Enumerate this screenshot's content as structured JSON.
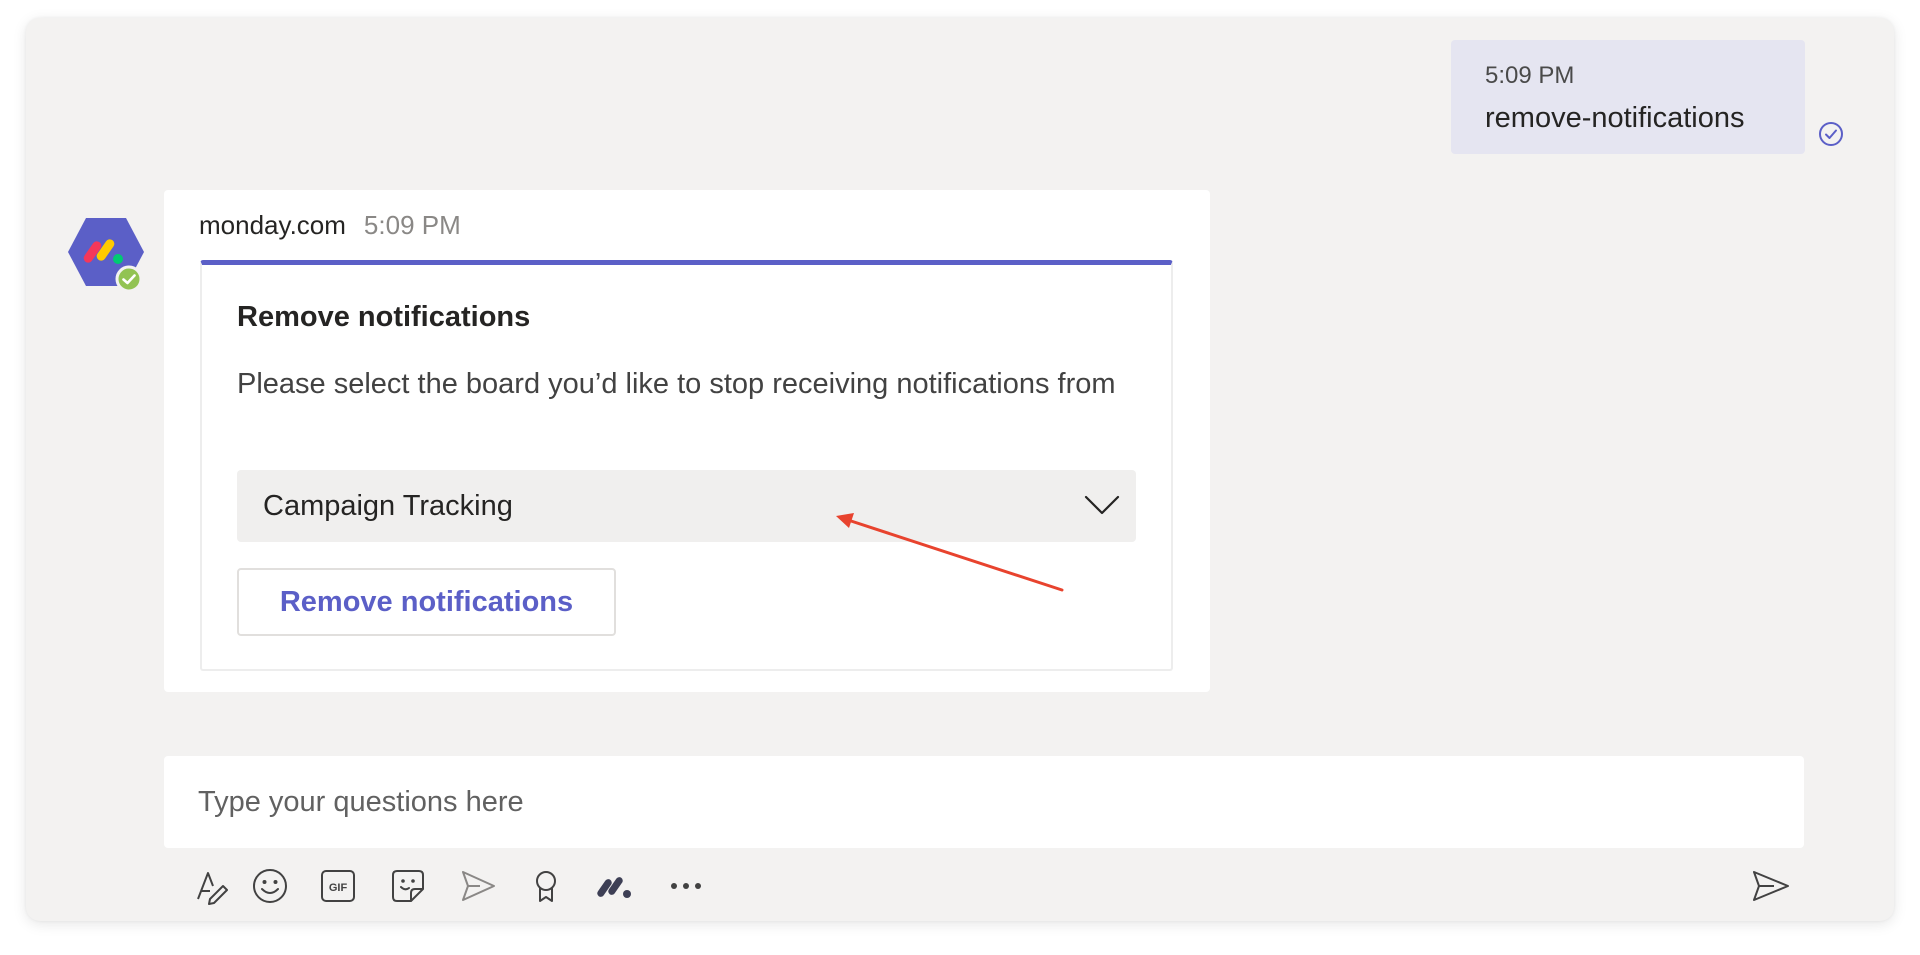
{
  "outgoing_message": {
    "time": "5:09 PM",
    "text": "remove-notifications"
  },
  "bot_message": {
    "sender": "monday.com",
    "time": "5:09 PM",
    "card": {
      "title": "Remove notifications",
      "description": "Please select the board you’d like to stop receiving notifications from",
      "select_value": "Campaign Tracking",
      "button_label": "Remove notifications"
    }
  },
  "compose": {
    "placeholder": "Type your questions here"
  },
  "toolbar": {
    "icons": [
      "format-icon",
      "emoji-icon",
      "gif-icon",
      "sticker-icon",
      "meet-icon",
      "praise-icon",
      "monday-app-icon",
      "more-icon"
    ],
    "gif_label": "GIF"
  },
  "colors": {
    "accent": "#5b5fc7",
    "annotation_arrow": "#e8432e",
    "avatar_hexagon": "#5b5fc7",
    "status_dot": "#92c353"
  }
}
